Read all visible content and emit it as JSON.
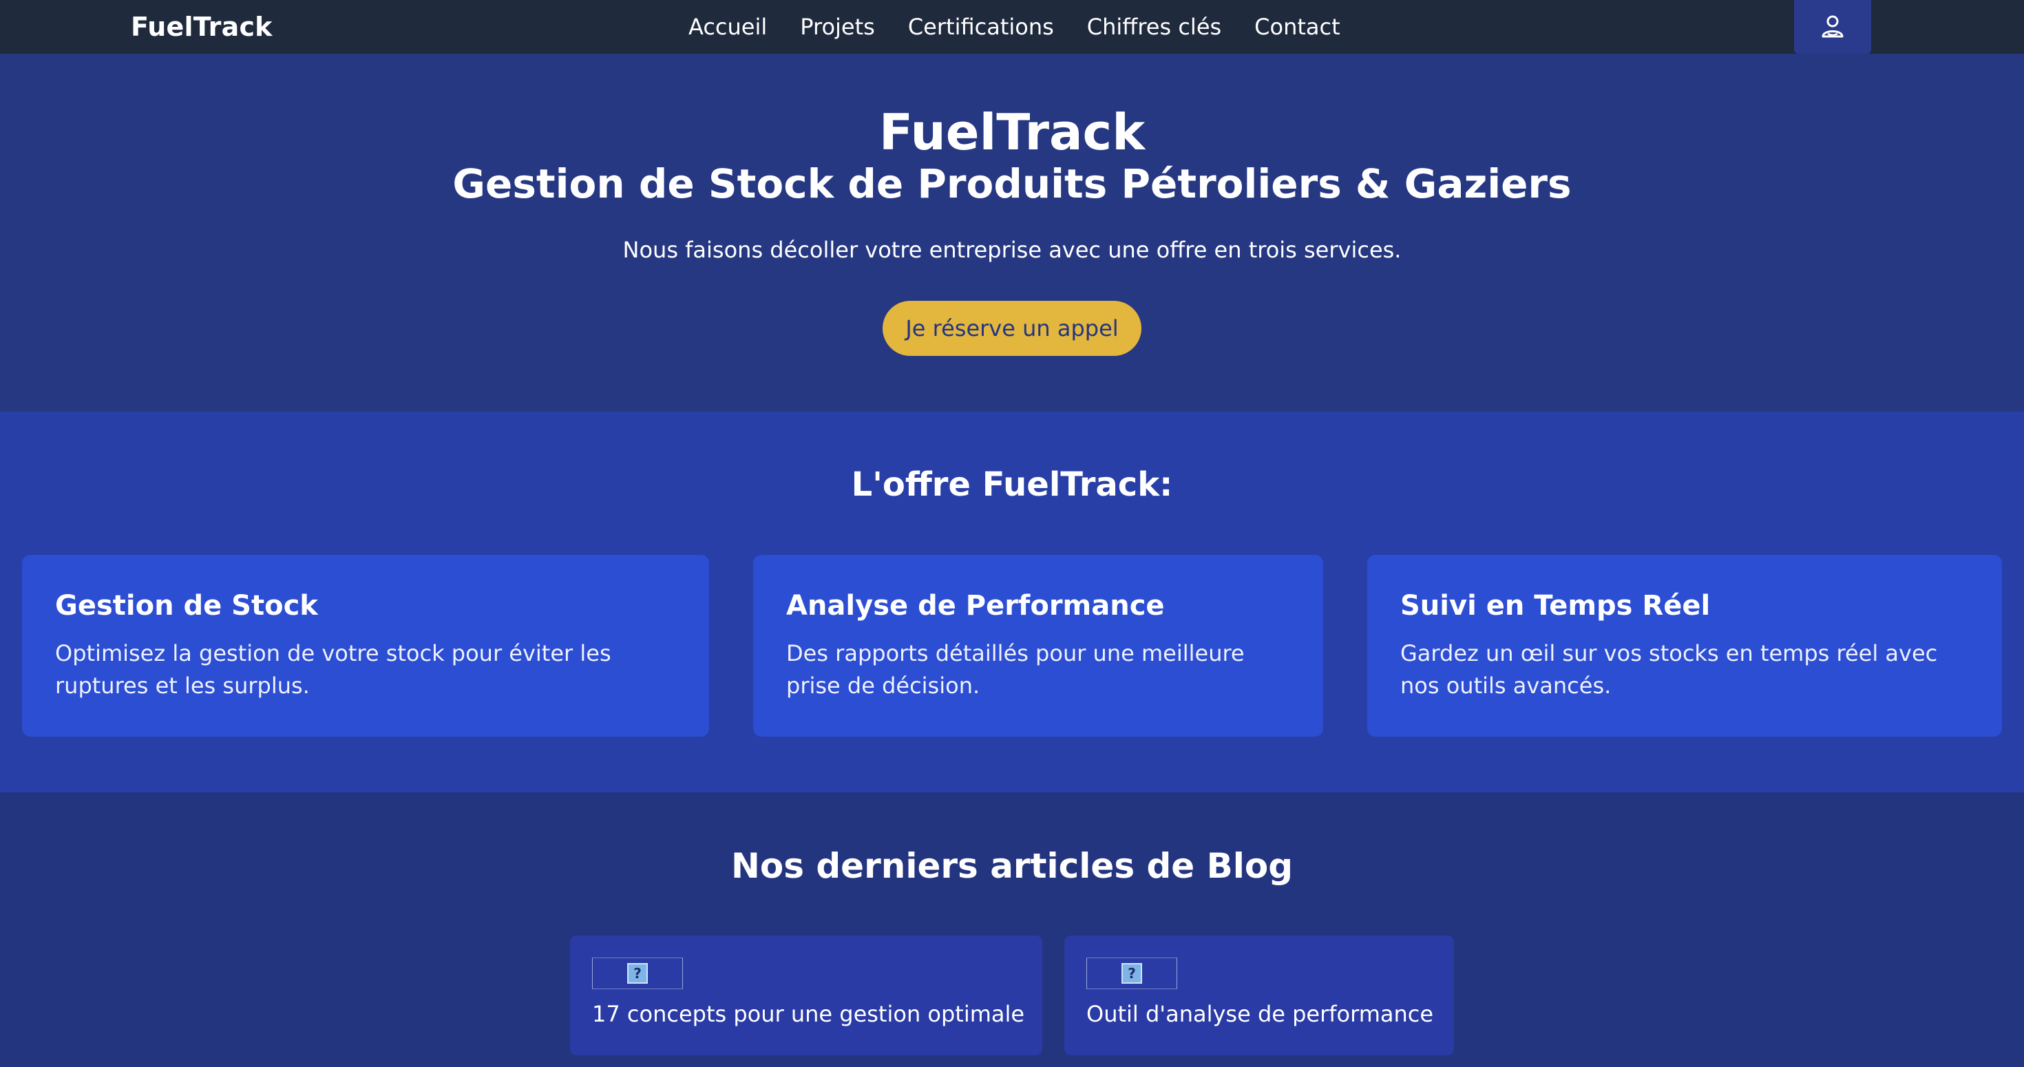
{
  "header": {
    "brand": "FuelTrack",
    "nav": [
      "Accueil",
      "Projets",
      "Certifications",
      "Chiffres clés",
      "Contact"
    ],
    "user_icon": "user-icon"
  },
  "hero": {
    "title": "FuelTrack",
    "subtitle": "Gestion de Stock de Produits Pétroliers & Gaziers",
    "tagline": "Nous faisons décoller votre entreprise avec une offre en trois services.",
    "cta_label": "Je réserve un appel"
  },
  "offer": {
    "heading": "L'offre FuelTrack:",
    "cards": [
      {
        "title": "Gestion de Stock",
        "lines": [
          "Optimisez la gestion de votre stock pour éviter les",
          "ruptures et les surplus."
        ]
      },
      {
        "title": "Analyse de Performance",
        "lines": [
          "Des rapports détaillés pour une meilleure",
          "prise de décision."
        ]
      },
      {
        "title": "Suivi en Temps Réel",
        "lines": [
          "Gardez un œil sur vos stocks en temps réel avec",
          "nos outils avancés."
        ]
      }
    ]
  },
  "blog": {
    "heading": "Nos derniers articles de Blog",
    "articles": [
      {
        "title": "17 concepts pour une gestion optimale",
        "image_icon": "broken-image-icon",
        "image_glyph": "?"
      },
      {
        "title": "Outil d'analyse de performance",
        "image_icon": "broken-image-icon",
        "image_glyph": "?"
      }
    ]
  },
  "colors": {
    "topbar": "#1f2a3d",
    "hero_bg": "#263882",
    "offer_bg": "#283fa8",
    "card_bg": "#2c4ed2",
    "cta": "#e3b63d"
  }
}
